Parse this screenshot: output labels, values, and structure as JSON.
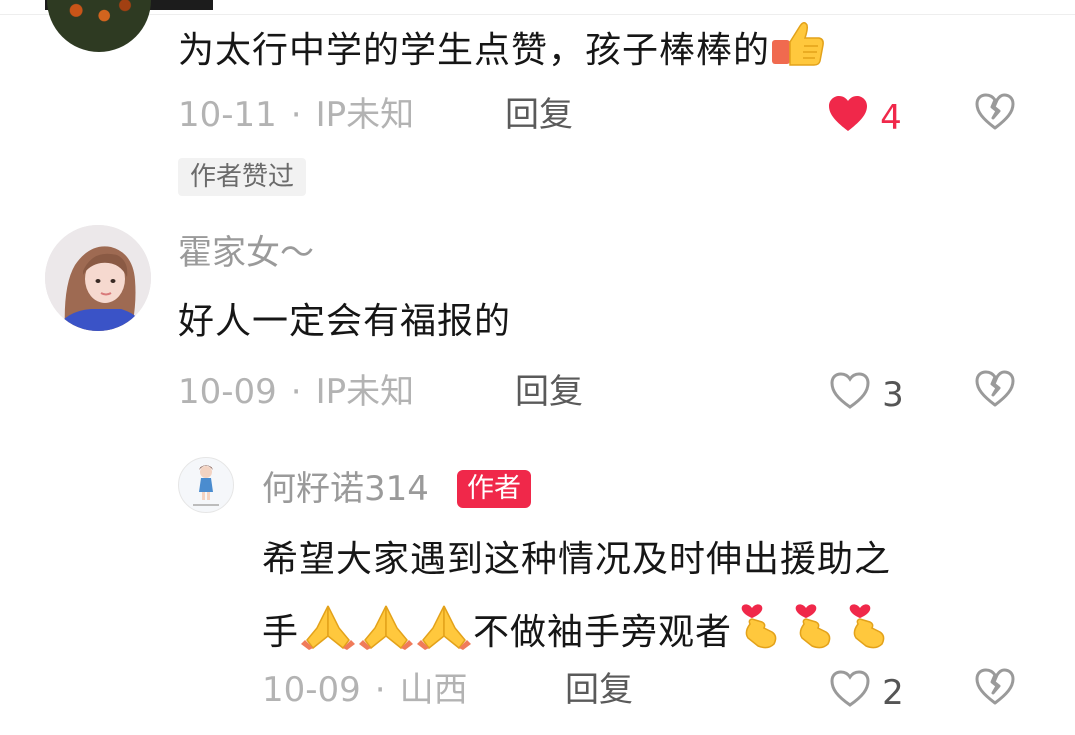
{
  "colors": {
    "like_red": "#f0284a",
    "meta_gray": "#b3b3b3",
    "author_badge": "#f0284a"
  },
  "comments": [
    {
      "text": "为太行中学的学生点赞，孩子棒棒的",
      "emoji": "thumbs-up-icon",
      "date": "10-11",
      "location": "IP未知",
      "reply_label": "回复",
      "likes": "4",
      "liked": true,
      "liked_by_author_label": "作者赞过"
    },
    {
      "username": "霍家女～",
      "text": "好人一定会有福报的",
      "date": "10-09",
      "location": "IP未知",
      "reply_label": "回复",
      "likes": "3",
      "liked": false
    }
  ],
  "reply": {
    "username": "何籽诺314",
    "author_badge": "作者",
    "text_line1": "希望大家遇到这种情况及时伸出援助之",
    "text_line2_prefix": "手",
    "text_line2_middle": "不做袖手旁观者",
    "emojis": [
      "folded-hands-icon",
      "finger-heart-icon"
    ],
    "date": "10-09",
    "location": "山西",
    "reply_label": "回复",
    "likes": "2",
    "liked": false
  },
  "separator": "·"
}
